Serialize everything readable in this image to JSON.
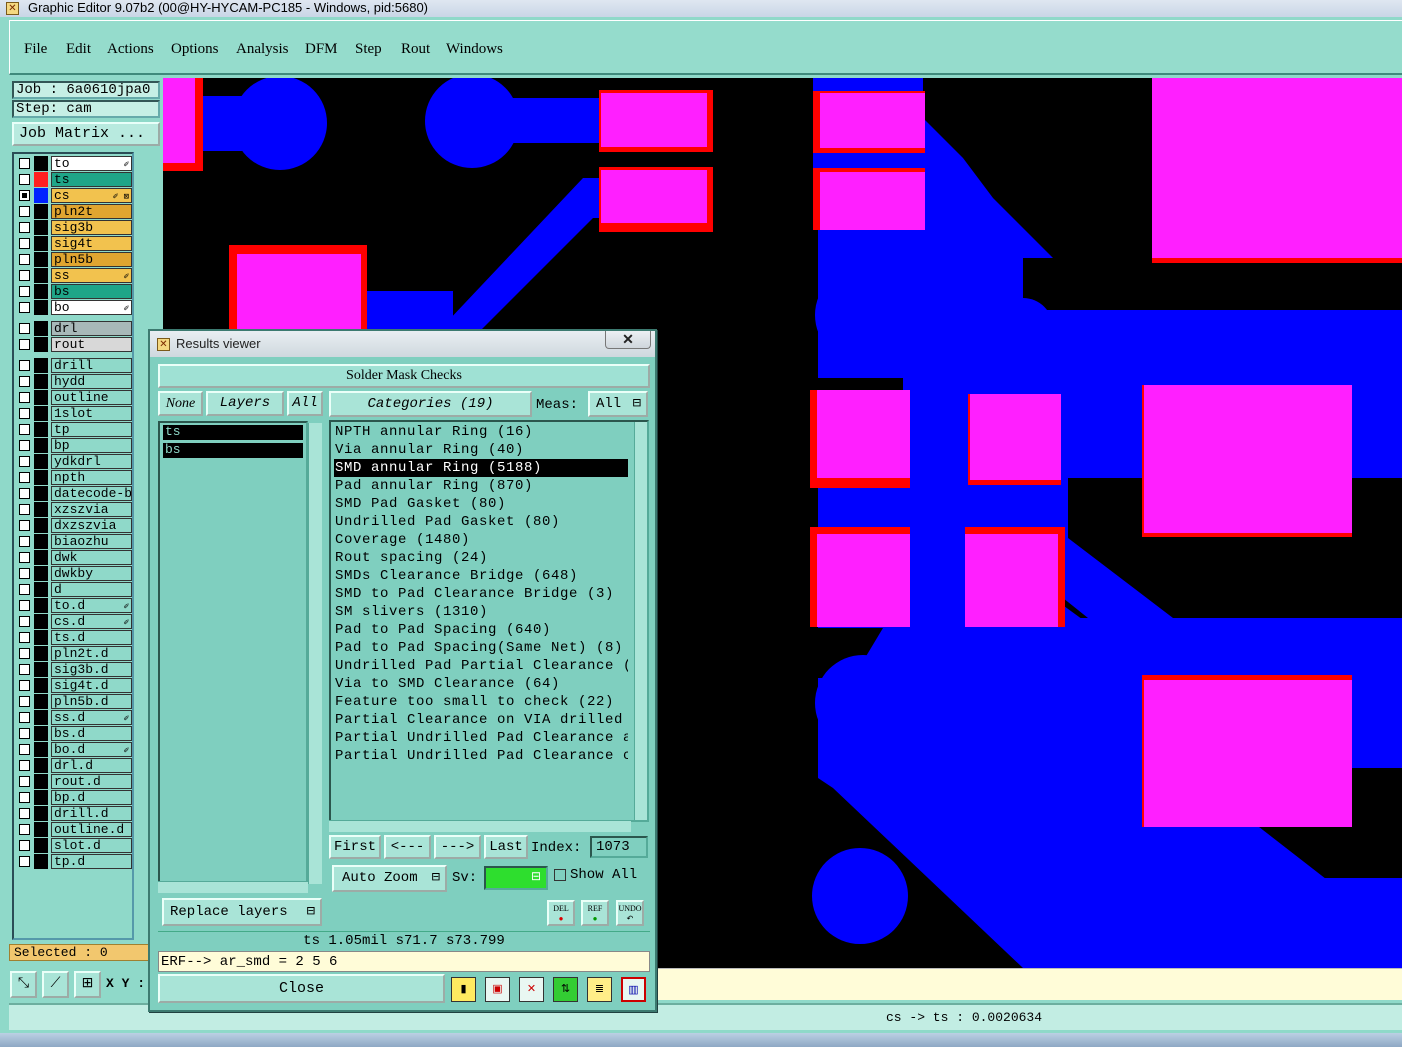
{
  "window": {
    "title": "Graphic Editor 9.07b2 (00@HY-HYCAM-PC185 - Windows, pid:5680)"
  },
  "menu": [
    "File",
    "Edit",
    "Actions",
    "Options",
    "Analysis",
    "DFM",
    "Step",
    "Rout",
    "Windows"
  ],
  "job": {
    "job_label": "Job : 6a0610jpa0",
    "step_label": "Step: cam",
    "matrix_button": "Job Matrix ..."
  },
  "layers": [
    {
      "name": "to",
      "color": "#ffffff",
      "swatch": "#000000",
      "checked": false,
      "mark": "✐"
    },
    {
      "name": "ts",
      "color": "#1fa588",
      "swatch": "#ff2020",
      "checked": false,
      "mark": ""
    },
    {
      "name": "cs",
      "color": "#f2c24e",
      "swatch": "#0022ff",
      "checked": true,
      "mark": "✐ ⊠"
    },
    {
      "name": "pln2t",
      "color": "#e0a530",
      "swatch": "#000000",
      "checked": false,
      "mark": ""
    },
    {
      "name": "sig3b",
      "color": "#f2c24e",
      "swatch": "#000000",
      "checked": false,
      "mark": ""
    },
    {
      "name": "sig4t",
      "color": "#f2c24e",
      "swatch": "#000000",
      "checked": false,
      "mark": ""
    },
    {
      "name": "pln5b",
      "color": "#e0a530",
      "swatch": "#000000",
      "checked": false,
      "mark": ""
    },
    {
      "name": "ss",
      "color": "#f2c24e",
      "swatch": "#000000",
      "checked": false,
      "mark": "✐"
    },
    {
      "name": "bs",
      "color": "#1fa588",
      "swatch": "#000000",
      "checked": false,
      "mark": ""
    },
    {
      "name": "bo",
      "color": "#ffffff",
      "swatch": "#000000",
      "checked": false,
      "mark": "✐"
    },
    {
      "name": "drl",
      "color": "#a8b8b8",
      "swatch": "#000000",
      "checked": false,
      "mark": ""
    },
    {
      "name": "rout",
      "color": "#d8d8d8",
      "swatch": "#000000",
      "checked": false,
      "mark": ""
    },
    {
      "name": "drill",
      "color": "#8fd9c9",
      "swatch": "#000000",
      "checked": false,
      "mark": ""
    },
    {
      "name": "hydd",
      "color": "#8fd9c9",
      "swatch": "#000000",
      "checked": false,
      "mark": ""
    },
    {
      "name": "outline",
      "color": "#8fd9c9",
      "swatch": "#000000",
      "checked": false,
      "mark": ""
    },
    {
      "name": "1slot",
      "color": "#8fd9c9",
      "swatch": "#000000",
      "checked": false,
      "mark": ""
    },
    {
      "name": "tp",
      "color": "#8fd9c9",
      "swatch": "#000000",
      "checked": false,
      "mark": ""
    },
    {
      "name": "bp",
      "color": "#8fd9c9",
      "swatch": "#000000",
      "checked": false,
      "mark": ""
    },
    {
      "name": "ydkdrl",
      "color": "#8fd9c9",
      "swatch": "#000000",
      "checked": false,
      "mark": ""
    },
    {
      "name": "npth",
      "color": "#8fd9c9",
      "swatch": "#000000",
      "checked": false,
      "mark": ""
    },
    {
      "name": "datecode-bo",
      "color": "#8fd9c9",
      "swatch": "#000000",
      "checked": false,
      "mark": ""
    },
    {
      "name": "xzszvia",
      "color": "#8fd9c9",
      "swatch": "#000000",
      "checked": false,
      "mark": ""
    },
    {
      "name": "dxzszvia",
      "color": "#8fd9c9",
      "swatch": "#000000",
      "checked": false,
      "mark": ""
    },
    {
      "name": "biaozhu",
      "color": "#8fd9c9",
      "swatch": "#000000",
      "checked": false,
      "mark": ""
    },
    {
      "name": "dwk",
      "color": "#8fd9c9",
      "swatch": "#000000",
      "checked": false,
      "mark": ""
    },
    {
      "name": "dwkby",
      "color": "#8fd9c9",
      "swatch": "#000000",
      "checked": false,
      "mark": ""
    },
    {
      "name": "d",
      "color": "#8fd9c9",
      "swatch": "#000000",
      "checked": false,
      "mark": ""
    },
    {
      "name": "to.d",
      "color": "#8fd9c9",
      "swatch": "#000000",
      "checked": false,
      "mark": "✐"
    },
    {
      "name": "cs.d",
      "color": "#8fd9c9",
      "swatch": "#000000",
      "checked": false,
      "mark": "✐"
    },
    {
      "name": "ts.d",
      "color": "#8fd9c9",
      "swatch": "#000000",
      "checked": false,
      "mark": ""
    },
    {
      "name": "pln2t.d",
      "color": "#8fd9c9",
      "swatch": "#000000",
      "checked": false,
      "mark": ""
    },
    {
      "name": "sig3b.d",
      "color": "#8fd9c9",
      "swatch": "#000000",
      "checked": false,
      "mark": ""
    },
    {
      "name": "sig4t.d",
      "color": "#8fd9c9",
      "swatch": "#000000",
      "checked": false,
      "mark": ""
    },
    {
      "name": "pln5b.d",
      "color": "#8fd9c9",
      "swatch": "#000000",
      "checked": false,
      "mark": ""
    },
    {
      "name": "ss.d",
      "color": "#8fd9c9",
      "swatch": "#000000",
      "checked": false,
      "mark": "✐"
    },
    {
      "name": "bs.d",
      "color": "#8fd9c9",
      "swatch": "#000000",
      "checked": false,
      "mark": ""
    },
    {
      "name": "bo.d",
      "color": "#8fd9c9",
      "swatch": "#000000",
      "checked": false,
      "mark": "✐"
    },
    {
      "name": "drl.d",
      "color": "#8fd9c9",
      "swatch": "#000000",
      "checked": false,
      "mark": ""
    },
    {
      "name": "rout.d",
      "color": "#8fd9c9",
      "swatch": "#000000",
      "checked": false,
      "mark": ""
    },
    {
      "name": "bp.d",
      "color": "#8fd9c9",
      "swatch": "#000000",
      "checked": false,
      "mark": ""
    },
    {
      "name": "drill.d",
      "color": "#8fd9c9",
      "swatch": "#000000",
      "checked": false,
      "mark": ""
    },
    {
      "name": "outline.d",
      "color": "#8fd9c9",
      "swatch": "#000000",
      "checked": false,
      "mark": ""
    },
    {
      "name": "slot.d",
      "color": "#8fd9c9",
      "swatch": "#000000",
      "checked": false,
      "mark": ""
    },
    {
      "name": "tp.d",
      "color": "#8fd9c9",
      "swatch": "#000000",
      "checked": false,
      "mark": ""
    }
  ],
  "selected_label": "Selected : 0",
  "xy_label": "X Y :",
  "coord_readout": "cs -> ts : 0.0020634",
  "dialog": {
    "title": "Results viewer",
    "close_x": "✕",
    "heading": "Solder Mask Checks",
    "none_btn": "None",
    "layers_btn": "Layers",
    "all_btn": "All",
    "layer_items": [
      "ts",
      "bs"
    ],
    "categories_btn": "Categories (19)",
    "meas_label": "Meas:",
    "meas_value": "All",
    "categories": [
      "NPTH annular Ring (16)",
      "Via annular Ring (40)",
      "SMD annular Ring (5188)",
      "Pad annular Ring (870)",
      "SMD Pad Gasket (80)",
      "Undrilled Pad Gasket (80)",
      "Coverage (1480)",
      "Rout spacing (24)",
      "SMDs Clearance Bridge (648)",
      "SMD to Pad Clearance Bridge (3)",
      "SM slivers (1310)",
      "Pad to Pad Spacing (640)",
      "Pad to Pad Spacing(Same Net) (8)",
      "Undrilled Pad Partial Clearance (",
      "Via to SMD Clearance (64)",
      "Feature too small to check (22)",
      "Partial Clearance on VIA drilled",
      "Partial Undrilled Pad Clearance a",
      "Partial Undrilled Pad Clearance c"
    ],
    "selected_category": 2,
    "first_btn": "First",
    "prev_btn": "<---",
    "next_btn": "--->",
    "last_btn": "Last",
    "index_label": "Index:",
    "index_value": "1073",
    "auto_zoom": "Auto Zoom",
    "sv_label": "Sv:",
    "show_all": "Show All",
    "replace_layers": "Replace layers",
    "del_btn": "DEL",
    "ref_btn": "REF",
    "undo_btn": "UNDO",
    "info_line": "ts 1.05mil  s71.7  s73.799",
    "erf_line": "ERF--> ar_smd = 2 5 6",
    "close_btn": "Close"
  },
  "colors": {
    "pad": "#ff1fff",
    "copper": "#0000ff",
    "mask_edge": "#ff0000",
    "board": "#000000",
    "panel": "#8fd9c9"
  }
}
